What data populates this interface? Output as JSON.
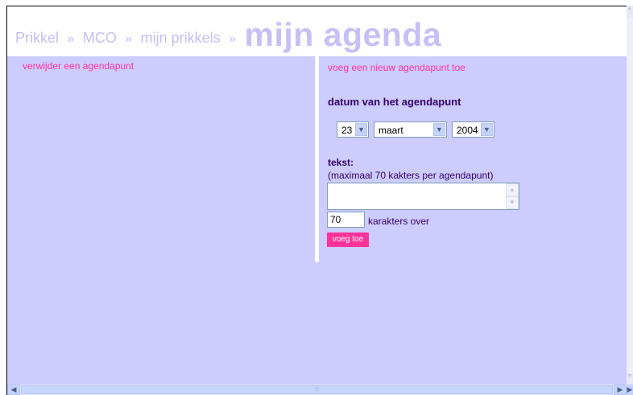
{
  "breadcrumb": {
    "items": [
      "Prikkel",
      "MCO",
      "mijn prikkels"
    ],
    "separator": "»",
    "current": "mijn agenda"
  },
  "left": {
    "title": "verwijder een agendapunt"
  },
  "right": {
    "title": "voeg een nieuw agendapunt toe",
    "date_label": "datum van het agendapunt",
    "day": "23",
    "month": "maart",
    "year": "2004",
    "text_label": "tekst:",
    "hint": "(maximaal 70 kakters per agendapunt)",
    "textarea_value": "",
    "counter_value": "70",
    "counter_label": "karakters over",
    "submit_label": "voeg toe"
  },
  "icons": {
    "dropdown": "chevron-down-icon",
    "scroll_up": "chevron-up-icon",
    "scroll_down": "chevron-down-icon",
    "scroll_left": "chevron-left-icon",
    "scroll_right": "chevron-right-icon"
  },
  "colors": {
    "content_bg": "#ccccff",
    "accent": "#ff3399",
    "text": "#330066",
    "header_text": "#c4bef4"
  }
}
